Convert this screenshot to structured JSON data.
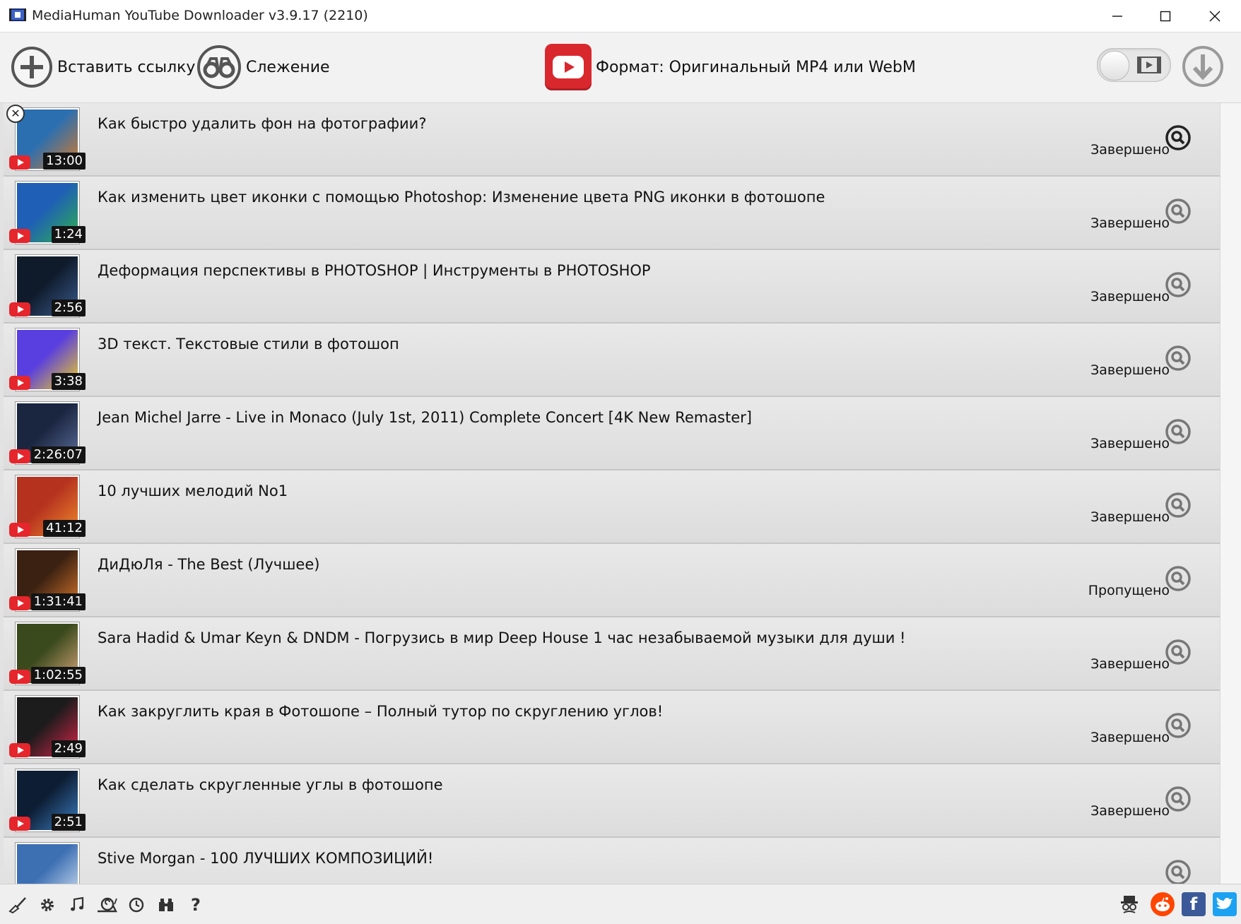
{
  "window": {
    "title": "MediaHuman YouTube Downloader v3.9.17 (2210)"
  },
  "toolbar": {
    "paste_label": "Вставить ссылку",
    "watch_label": "Слежение",
    "format_label": "Формат: Оригинальный MP4 или WebM"
  },
  "items": [
    {
      "title": "Как быстро удалить фон на фотографии?",
      "duration": "13:00",
      "status": "Завершено",
      "thumb_colors": [
        "#2b6fb0",
        "#d77a2a"
      ]
    },
    {
      "title": "Как изменить цвет иконки с помощью Photoshop: Изменение цвета PNG иконки в фотошопе",
      "duration": "1:24",
      "status": "Завершено",
      "thumb_colors": [
        "#1f5fb5",
        "#2fb24d"
      ]
    },
    {
      "title": "Деформация перспективы в PHOTOSHOP | Инструменты в PHOTOSHOP",
      "duration": "2:56",
      "status": "Завершено",
      "thumb_colors": [
        "#0f1a2a",
        "#3a5c8f"
      ]
    },
    {
      "title": "3D текст. Текстовые стили в фотошоп",
      "duration": "3:38",
      "status": "Завершено",
      "thumb_colors": [
        "#5a3fe0",
        "#f2d21c"
      ]
    },
    {
      "title": "Jean Michel Jarre - Live in Monaco (July 1st, 2011) Complete Concert [4K New Remaster]",
      "duration": "2:26:07",
      "status": "Завершено",
      "thumb_colors": [
        "#1a2540",
        "#5d6f9c"
      ]
    },
    {
      "title": "10 лучших мелодий No1",
      "duration": "41:12",
      "status": "Завершено",
      "thumb_colors": [
        "#b5321f",
        "#f08a2c"
      ]
    },
    {
      "title": "ДиДюЛя - The Best (Лучшее)",
      "duration": "1:31:41",
      "status": "Пропущено",
      "thumb_colors": [
        "#3b2112",
        "#d9772b"
      ]
    },
    {
      "title": "Sara Hadid & Umar Keyn & DNDM - Погрузись в мир Deep House 1 час незабываемой музыки для души !",
      "duration": "1:02:55",
      "status": "Завершено",
      "thumb_colors": [
        "#3a4a1c",
        "#d8a57a"
      ]
    },
    {
      "title": "Как закруглить края в Фотошопе – Полный тутор по скруглению углов!",
      "duration": "2:49",
      "status": "Завершено",
      "thumb_colors": [
        "#1c1c1c",
        "#d8244a"
      ]
    },
    {
      "title": "Как сделать скругленные углы в фотошопе",
      "duration": "2:51",
      "status": "Завершено",
      "thumb_colors": [
        "#0d1d33",
        "#3b7ec2"
      ]
    },
    {
      "title": "Stive Morgan - 100 ЛУЧШИХ КОМПОЗИЦИЙ!",
      "duration": "",
      "status": "",
      "thumb_colors": [
        "#3d6fb3",
        "#d9e6f5"
      ]
    }
  ],
  "colors": {
    "accent_red": "#d9272e",
    "facebook": "#3b5998",
    "twitter": "#1da1f2",
    "reddit": "#ff4500"
  },
  "icons": {
    "bottom_left": [
      "broom-icon",
      "gear-icon",
      "music-note-icon",
      "snail-icon",
      "clock-icon",
      "binoculars-icon",
      "help-icon"
    ],
    "bottom_right": [
      "spy-icon",
      "reddit-icon",
      "facebook-icon",
      "twitter-icon"
    ]
  },
  "bottombar": {
    "help_glyph": "?",
    "facebook_glyph": "f"
  }
}
